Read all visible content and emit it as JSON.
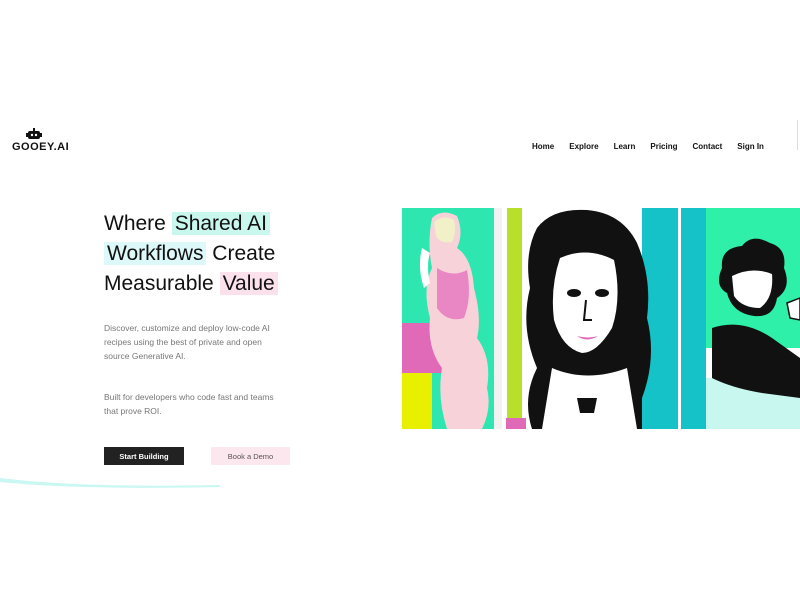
{
  "brand": {
    "name": "GOOEY.AI",
    "logo_icon": "robot-icon"
  },
  "nav": {
    "items": [
      {
        "label": "Home"
      },
      {
        "label": "Explore"
      },
      {
        "label": "Learn"
      },
      {
        "label": "Pricing"
      },
      {
        "label": "Contact"
      },
      {
        "label": "Sign In"
      }
    ]
  },
  "hero": {
    "headline": {
      "part1": "Where ",
      "hl1": "Shared AI",
      "hl2": "Workflows",
      "part2": " Create",
      "part3": "Measurable ",
      "hl3": "Value"
    },
    "description": "Discover, customize and deploy low-code AI recipes using the best of private and open source Generative AI.",
    "description2": "Built for developers who code fast and teams that prove ROI.",
    "primary_cta": "Start Building",
    "secondary_cta": "Book a Demo"
  },
  "colors": {
    "highlight_teal": "#c9f7ee",
    "highlight_cyan": "#ddf8f9",
    "highlight_pink": "#fbe1ec",
    "button_dark": "#222222",
    "button_pink": "#fde7ee"
  }
}
